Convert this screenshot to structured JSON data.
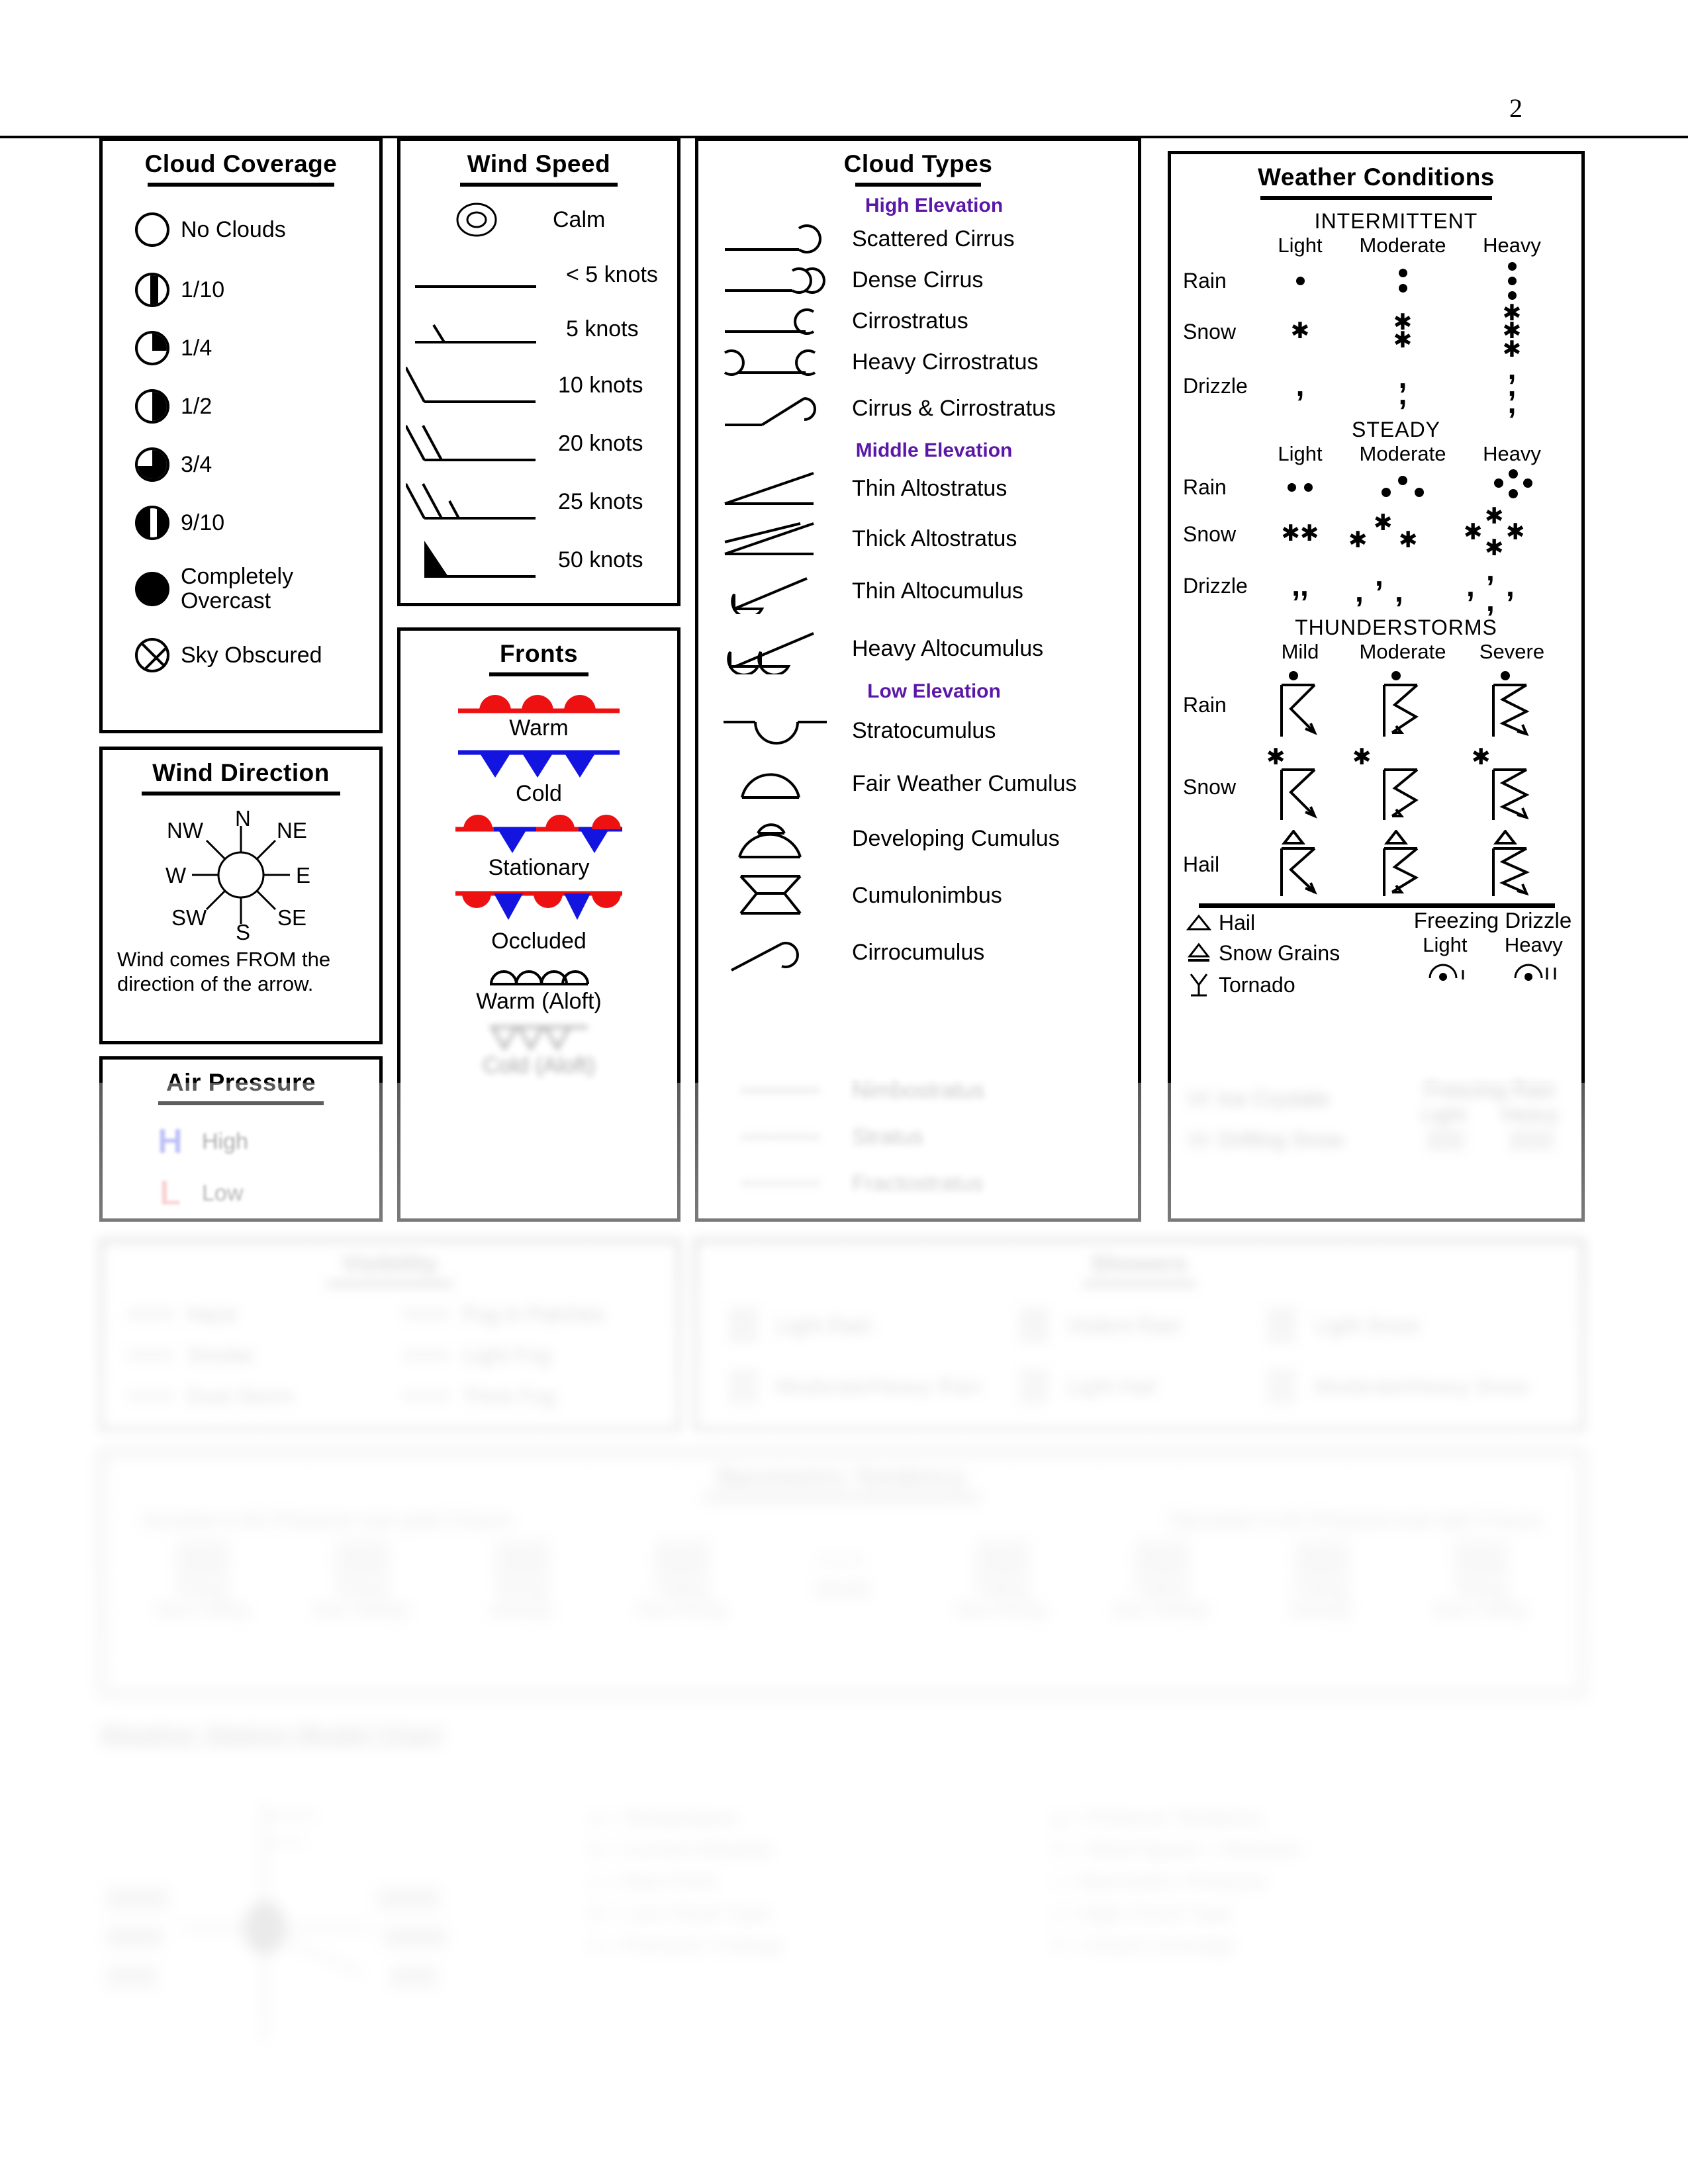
{
  "page": {
    "number": "2"
  },
  "colors": {
    "warm_front": "#ee1111",
    "cold_front": "#1414e0",
    "elevation_heading": "#5b17a8",
    "high_pressure": "#3b46e8",
    "low_pressure": "#f06a72",
    "rule": "#000000"
  },
  "cloud_coverage": {
    "title": "Cloud Coverage",
    "items": [
      {
        "symbol": "circle-empty",
        "label": "No Clouds"
      },
      {
        "symbol": "circle-bar-1-10",
        "label": "1/10"
      },
      {
        "symbol": "circle-quarter",
        "label": "1/4"
      },
      {
        "symbol": "circle-half",
        "label": "1/2"
      },
      {
        "symbol": "circle-three-quarter",
        "label": "3/4"
      },
      {
        "symbol": "circle-bar-9-10",
        "label": "9/10"
      },
      {
        "symbol": "circle-full",
        "label": "Completely Overcast"
      },
      {
        "symbol": "circle-x",
        "label": "Sky Obscured"
      }
    ]
  },
  "wind_direction": {
    "title": "Wind  Direction",
    "compass": [
      "N",
      "NE",
      "E",
      "SE",
      "S",
      "SW",
      "W",
      "NW"
    ],
    "note": "Wind comes FROM the direction of the arrow."
  },
  "air_pressure": {
    "title": "Air Pressure",
    "items": [
      {
        "symbol": "blue-H",
        "label": "High"
      },
      {
        "symbol": "red-L",
        "label": "Low"
      }
    ]
  },
  "wind_speed": {
    "title": "Wind Speed",
    "items": [
      {
        "symbol": "calm-double-circle",
        "label": "Calm"
      },
      {
        "symbol": "bare-shaft",
        "label": "< 5 knots"
      },
      {
        "symbol": "half-barb",
        "label": "5 knots"
      },
      {
        "symbol": "one-full-barb",
        "label": "10 knots"
      },
      {
        "symbol": "two-full-barbs",
        "label": "20 knots"
      },
      {
        "symbol": "two-full-one-half",
        "label": "25 knots"
      },
      {
        "symbol": "pennant",
        "label": "50 knots"
      }
    ]
  },
  "fronts": {
    "title": "Fronts",
    "items": [
      {
        "symbol": "warm-front",
        "label": "Warm"
      },
      {
        "symbol": "cold-front",
        "label": "Cold"
      },
      {
        "symbol": "stationary-front",
        "label": "Stationary"
      },
      {
        "symbol": "occluded-front",
        "label": "Occluded"
      },
      {
        "symbol": "warm-front-aloft",
        "label": "Warm  (Aloft)"
      },
      {
        "symbol": "cold-front-aloft",
        "label": "Cold  (Aloft)"
      }
    ]
  },
  "cloud_types": {
    "title": "Cloud Types",
    "groups": [
      {
        "heading": "High Elevation",
        "items": [
          {
            "symbol": "scattered-cirrus",
            "label": "Scattered Cirrus"
          },
          {
            "symbol": "dense-cirrus",
            "label": "Dense Cirrus"
          },
          {
            "symbol": "cirrostratus",
            "label": "Cirrostratus"
          },
          {
            "symbol": "heavy-cirrostratus",
            "label": "Heavy Cirrostratus"
          },
          {
            "symbol": "cirrus-and-cirrostratus",
            "label": "Cirrus & Cirrostratus"
          }
        ]
      },
      {
        "heading": "Middle Elevation",
        "items": [
          {
            "symbol": "thin-altostratus",
            "label": "Thin Altostratus"
          },
          {
            "symbol": "thick-altostratus",
            "label": "Thick Altostratus"
          },
          {
            "symbol": "thin-altocumulus",
            "label": "Thin Altocumulus"
          },
          {
            "symbol": "heavy-altocumulus",
            "label": "Heavy Altocumulus"
          }
        ]
      },
      {
        "heading": "Low Elevation",
        "items": [
          {
            "symbol": "stratocumulus",
            "label": "Stratocumulus"
          },
          {
            "symbol": "fair-weather-cumulus",
            "label": "Fair Weather Cumulus"
          },
          {
            "symbol": "developing-cumulus",
            "label": "Developing Cumulus"
          },
          {
            "symbol": "cumulonimbus",
            "label": "Cumulonimbus"
          },
          {
            "symbol": "cirrocumulus",
            "label": "Cirrocumulus"
          },
          {
            "symbol": "nimbostratus",
            "label": "Nimbostratus"
          },
          {
            "symbol": "stratus",
            "label": "Stratus"
          },
          {
            "symbol": "fractostratus",
            "label": "Fractostratus"
          }
        ]
      }
    ]
  },
  "weather_conditions": {
    "title": "Weather Conditions",
    "sections": [
      {
        "name": "INTERMITTENT",
        "columns": [
          "Light",
          "Moderate",
          "Heavy"
        ],
        "rows": [
          "Rain",
          "Snow",
          "Drizzle"
        ]
      },
      {
        "name": "STEADY",
        "columns": [
          "Light",
          "Moderate",
          "Heavy"
        ],
        "rows": [
          "Rain",
          "Snow",
          "Drizzle"
        ]
      },
      {
        "name": "THUNDERSTORMS",
        "columns": [
          "Mild",
          "Moderate",
          "Severe"
        ],
        "rows": [
          "Rain",
          "Snow",
          "Hail"
        ]
      }
    ],
    "misc_left": [
      {
        "symbol": "hail-triangle",
        "label": "Hail"
      },
      {
        "symbol": "snow-grains",
        "label": "Snow Grains"
      },
      {
        "symbol": "tornado",
        "label": "Tornado"
      },
      {
        "symbol": "ice-crystals",
        "label": "Ice Crystals"
      },
      {
        "symbol": "drifting-snow",
        "label": "Drifting Snow"
      }
    ],
    "freezing_drizzle": {
      "heading": "Freezing Drizzle",
      "columns": [
        "Light",
        "Heavy"
      ]
    },
    "freezing_rain": {
      "heading": "Freezing Rain",
      "columns": [
        "Light",
        "Heavy"
      ]
    }
  },
  "visibility": {
    "title": "Visibility",
    "left_items": [
      {
        "symbol": "haze-row",
        "label": "Haze"
      },
      {
        "symbol": "smoke-row",
        "label": "Smoke"
      },
      {
        "symbol": "dust-storm",
        "label": "Dust Storm"
      }
    ],
    "right_items": [
      {
        "symbol": "fog-patches",
        "label": "Fog in Patches"
      },
      {
        "symbol": "light-fog",
        "label": "Light Fog"
      },
      {
        "symbol": "thick-fog",
        "label": "Thick Fog"
      }
    ]
  },
  "showers": {
    "title": "Showers",
    "items": [
      {
        "symbol": "light-rain-shower",
        "label": "Light Rain"
      },
      {
        "symbol": "violent-rain-shower",
        "label": "Violent Rain"
      },
      {
        "symbol": "light-snow-shower",
        "label": "Light Snow"
      },
      {
        "symbol": "moderate-heavy-rain-shower",
        "label": "Moderate/Heavy Rain"
      },
      {
        "symbol": "light-hail-shower",
        "label": "Light Hail"
      },
      {
        "symbol": "moderate-heavy-snow-shower",
        "label": "Moderate/Heavy Snow"
      }
    ]
  },
  "barometric": {
    "title": "Barometric Tendency",
    "left_note": "Increase in Air Pressure over past 3 hours",
    "right_note": "Decrease in Air Pressure over last 3 hours",
    "items": [
      {
        "label": "Rising\nthen Falling"
      },
      {
        "label": "Rising\nthen Steady"
      },
      {
        "label": "Rising\nSteadily"
      },
      {
        "label": "Falling\nthen Rising"
      },
      {
        "label": "Steady"
      },
      {
        "label": "Falling\nthen Rising"
      },
      {
        "label": "Falling\nthen Steady"
      },
      {
        "label": "Falling\nSteadily"
      },
      {
        "label": "Rising\nthen Falling"
      }
    ]
  },
  "station_model": {
    "title": "Weather Station Model Chart",
    "left_labels": [
      "a = 736",
      "b = 1/4",
      "c = 28"
    ],
    "right_labels": [
      "d = 043",
      "e = +28",
      "f = 12"
    ],
    "legend_left": [
      "a  =  Temperature",
      "b  =  Current  Weather",
      "c  =  Dew  Point",
      "d  =  Low  Cloud  Type",
      "e  =  Pressure  Change",
      "f  =  Pressure  Tendency"
    ],
    "legend_right": [
      "g  =  Pressure  Tendency",
      "h  =  Wind  Speed  +  Direction",
      "i  =  Barometric  Pressure",
      "j  =  High  Cloud  Type",
      "k  =  Cloud  Coverage"
    ]
  }
}
